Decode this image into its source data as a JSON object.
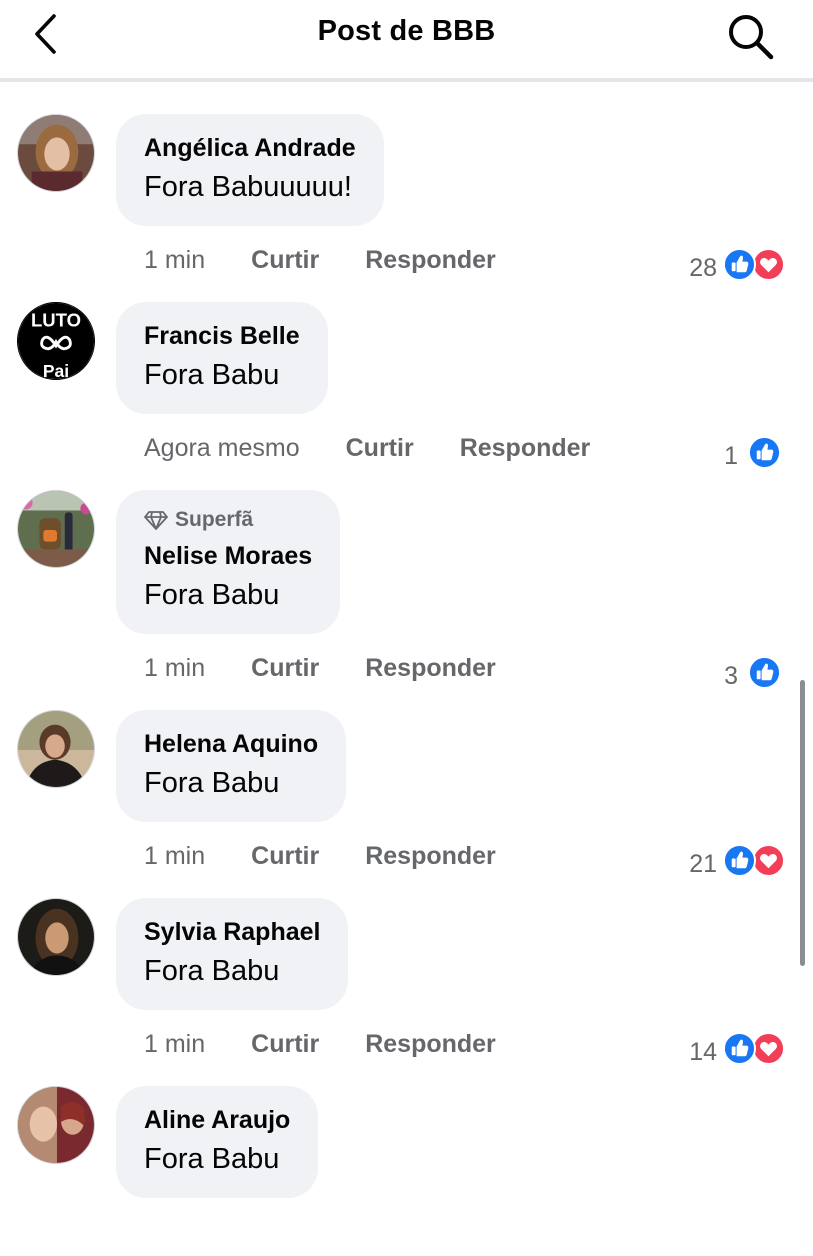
{
  "header": {
    "title": "Post de BBB",
    "back_icon": "chevron-left-icon",
    "search_icon": "search-icon"
  },
  "comments": [
    {
      "name": "Angélica Andrade",
      "text": "Fora Babuuuuu!",
      "time": "1 min",
      "like_label": "Curtir",
      "reply_label": "Responder",
      "reaction_count": "28",
      "reactions": [
        "like",
        "love"
      ]
    },
    {
      "name": "Francis Belle",
      "text": "Fora Babu",
      "time": "Agora mesmo",
      "like_label": "Curtir",
      "reply_label": "Responder",
      "reaction_count": "1",
      "reactions": [
        "like"
      ],
      "avatar_text_top": "LUTO",
      "avatar_text_bottom": "Pai"
    },
    {
      "name": "Nelise Moraes",
      "badge": "Superfã",
      "text": "Fora Babu",
      "time": "1 min",
      "like_label": "Curtir",
      "reply_label": "Responder",
      "reaction_count": "3",
      "reactions": [
        "like"
      ]
    },
    {
      "name": "Helena Aquino",
      "text": "Fora Babu",
      "time": "1 min",
      "like_label": "Curtir",
      "reply_label": "Responder",
      "reaction_count": "21",
      "reactions": [
        "like",
        "love"
      ]
    },
    {
      "name": "Sylvia Raphael",
      "text": "Fora Babu",
      "time": "1 min",
      "like_label": "Curtir",
      "reply_label": "Responder",
      "reaction_count": "14",
      "reactions": [
        "like",
        "love"
      ]
    },
    {
      "name": "Aline Araujo",
      "text": "Fora Babu"
    }
  ],
  "colors": {
    "like_blue": "#1877f2",
    "love_red": "#f33e58",
    "bubble_bg": "#f0f2f5",
    "meta_gray": "#65676b"
  }
}
